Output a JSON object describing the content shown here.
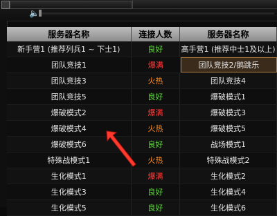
{
  "colors": {
    "good": "#5fdc3b",
    "hot": "#ff8a1e",
    "full": "#ff3c3c"
  },
  "icons": {
    "speaker": "speaker-icon",
    "pointer": "arrow-icon"
  },
  "columns": {
    "server_name_left": "服务器名称",
    "players": "连接人数",
    "server_name_right": "服务器名称"
  },
  "rows": [
    {
      "left": "新手营1 (推荐列兵1 ~ 下士1)",
      "status": "良好",
      "status_type": "good",
      "right": "高手营1 (推荐中士1及以上)"
    },
    {
      "left": "团队竞技1",
      "status": "爆满",
      "status_type": "full",
      "right": "团队竞技2/鹅跳乐",
      "right_selected": true
    },
    {
      "left": "团队竞技3",
      "status": "火热",
      "status_type": "hot",
      "right": "团队竞技4"
    },
    {
      "left": "团队竞技5",
      "status": "良好",
      "status_type": "good",
      "right": "爆破模式1"
    },
    {
      "left": "爆破模式2",
      "status": "爆满",
      "status_type": "full",
      "right": "爆破模式3"
    },
    {
      "left": "爆破模式4",
      "status": "火热",
      "status_type": "hot",
      "right": "爆破模式5"
    },
    {
      "left": "爆破模式6",
      "status": "良好",
      "status_type": "good",
      "right": "战场模式1"
    },
    {
      "left": "特殊战模式1",
      "status": "火热",
      "status_type": "hot",
      "right": "特殊战模式2"
    },
    {
      "left": "生化模式1",
      "status": "爆满",
      "status_type": "full",
      "right": "生化模式2"
    },
    {
      "left": "生化模式3",
      "status": "良好",
      "status_type": "good",
      "right": "生化模式4"
    },
    {
      "left": "生化模式5",
      "status": "良好",
      "status_type": "good",
      "right": "生化模式6"
    }
  ]
}
